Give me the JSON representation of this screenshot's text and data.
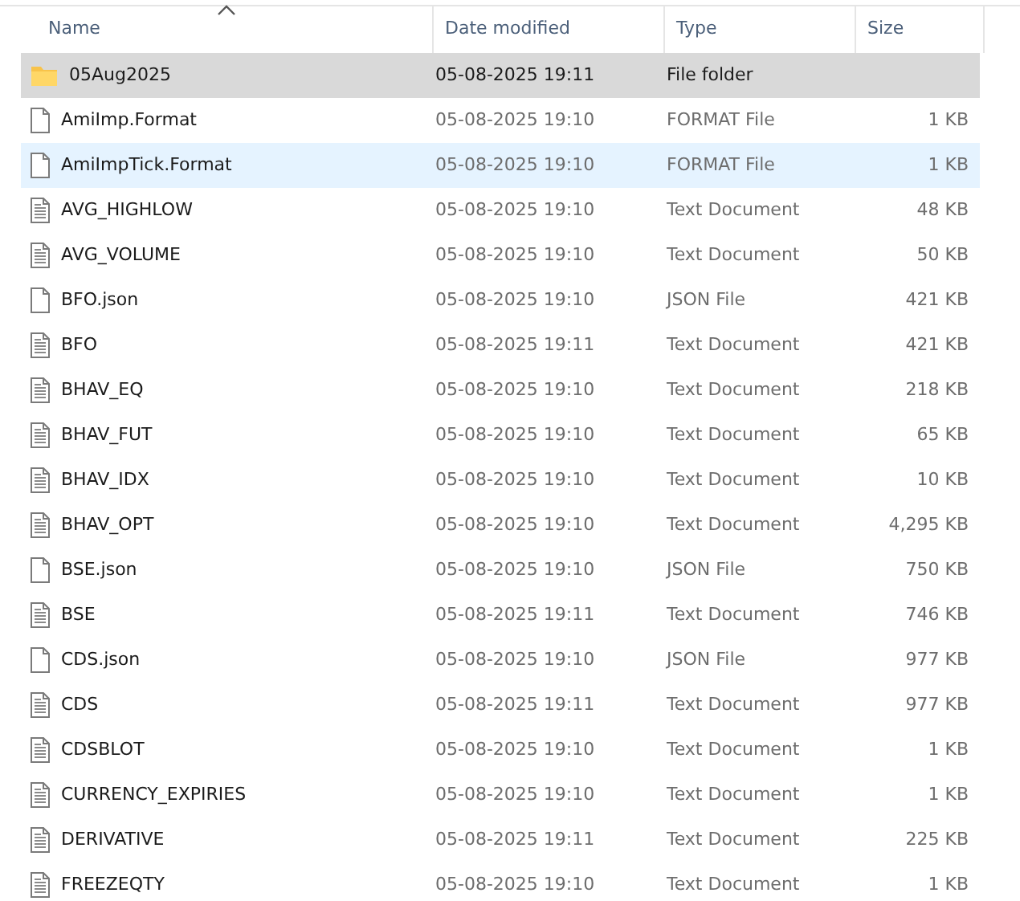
{
  "columns": [
    {
      "label": "Name",
      "sorted": true
    },
    {
      "label": "Date modified",
      "sorted": false
    },
    {
      "label": "Type",
      "sorted": false
    },
    {
      "label": "Size",
      "sorted": false
    }
  ],
  "rows": [
    {
      "kind": "folder",
      "name": "05Aug2025",
      "date": "05-08-2025 19:11",
      "type": "File folder",
      "selected": true,
      "hovered": false
    },
    {
      "kind": "file",
      "name": "AmiImp.Format",
      "date": "05-08-2025 19:10",
      "type": "FORMAT File",
      "size": "1 KB",
      "selected": false,
      "hovered": false
    },
    {
      "kind": "file",
      "name": "AmiImpTick.Format",
      "date": "05-08-2025 19:10",
      "type": "FORMAT File",
      "size": "1 KB",
      "selected": false,
      "hovered": true
    },
    {
      "kind": "text",
      "name": "AVG_HIGHLOW",
      "date": "05-08-2025 19:10",
      "type": "Text Document",
      "size": "48 KB",
      "selected": false,
      "hovered": false
    },
    {
      "kind": "text",
      "name": "AVG_VOLUME",
      "date": "05-08-2025 19:10",
      "type": "Text Document",
      "size": "50 KB",
      "selected": false,
      "hovered": false
    },
    {
      "kind": "file",
      "name": "BFO.json",
      "date": "05-08-2025 19:10",
      "type": "JSON File",
      "size": "421 KB",
      "selected": false,
      "hovered": false
    },
    {
      "kind": "text",
      "name": "BFO",
      "date": "05-08-2025 19:11",
      "type": "Text Document",
      "size": "421 KB",
      "selected": false,
      "hovered": false
    },
    {
      "kind": "text",
      "name": "BHAV_EQ",
      "date": "05-08-2025 19:10",
      "type": "Text Document",
      "size": "218 KB",
      "selected": false,
      "hovered": false
    },
    {
      "kind": "text",
      "name": "BHAV_FUT",
      "date": "05-08-2025 19:10",
      "type": "Text Document",
      "size": "65 KB",
      "selected": false,
      "hovered": false
    },
    {
      "kind": "text",
      "name": "BHAV_IDX",
      "date": "05-08-2025 19:10",
      "type": "Text Document",
      "size": "10 KB",
      "selected": false,
      "hovered": false
    },
    {
      "kind": "text",
      "name": "BHAV_OPT",
      "date": "05-08-2025 19:10",
      "type": "Text Document",
      "size": "4,295 KB",
      "selected": false,
      "hovered": false
    },
    {
      "kind": "file",
      "name": "BSE.json",
      "date": "05-08-2025 19:10",
      "type": "JSON File",
      "size": "750 KB",
      "selected": false,
      "hovered": false
    },
    {
      "kind": "text",
      "name": "BSE",
      "date": "05-08-2025 19:11",
      "type": "Text Document",
      "size": "746 KB",
      "selected": false,
      "hovered": false
    },
    {
      "kind": "file",
      "name": "CDS.json",
      "date": "05-08-2025 19:10",
      "type": "JSON File",
      "size": "977 KB",
      "selected": false,
      "hovered": false
    },
    {
      "kind": "text",
      "name": "CDS",
      "date": "05-08-2025 19:11",
      "type": "Text Document",
      "size": "977 KB",
      "selected": false,
      "hovered": false
    },
    {
      "kind": "text",
      "name": "CDSBLOT",
      "date": "05-08-2025 19:10",
      "type": "Text Document",
      "size": "1 KB",
      "selected": false,
      "hovered": false
    },
    {
      "kind": "text",
      "name": "CURRENCY_EXPIRIES",
      "date": "05-08-2025 19:10",
      "type": "Text Document",
      "size": "1 KB",
      "selected": false,
      "hovered": false
    },
    {
      "kind": "text",
      "name": "DERIVATIVE",
      "date": "05-08-2025 19:11",
      "type": "Text Document",
      "size": "225 KB",
      "selected": false,
      "hovered": false
    },
    {
      "kind": "text",
      "name": "FREEZEQTY",
      "date": "05-08-2025 19:10",
      "type": "Text Document",
      "size": "1 KB",
      "selected": false,
      "hovered": false
    }
  ]
}
